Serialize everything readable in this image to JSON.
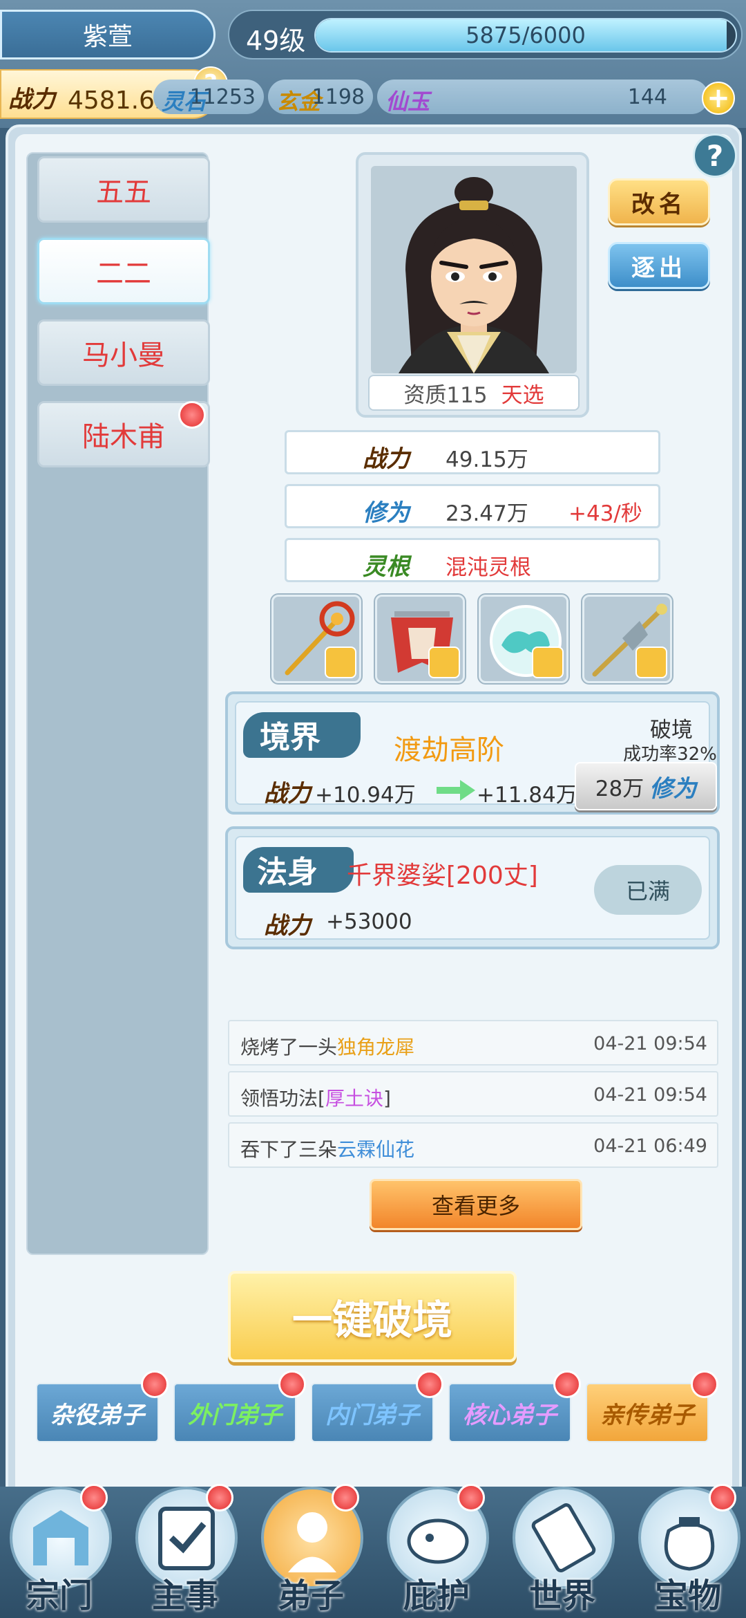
{
  "header": {
    "player_name": "紫萱",
    "level": "49级",
    "exp": "5875/6000",
    "exp_fraction": 0.979,
    "power_label": "战力",
    "power_value": "4581.63万",
    "help_glyph": "?",
    "resources": [
      {
        "label": "灵石",
        "value": "11253",
        "color": "#2b7fc0"
      },
      {
        "label": "玄金",
        "value": "1198",
        "color": "#c98a00"
      },
      {
        "label": "仙玉",
        "value": "144",
        "color": "#a24ad0"
      }
    ],
    "plus_glyph": "+"
  },
  "help_glyph": "?",
  "disciples": [
    {
      "name": "五五",
      "selected": false,
      "alert": false
    },
    {
      "name": "二二",
      "selected": true,
      "alert": false
    },
    {
      "name": "马小曼",
      "selected": false,
      "alert": false
    },
    {
      "name": "陆木甫",
      "selected": false,
      "alert": true
    }
  ],
  "portrait": {
    "aptitude": "资质115",
    "tag": "天选"
  },
  "actions": {
    "rename": "改名",
    "leave": "逐出"
  },
  "stats": {
    "power_label": "战力",
    "power_value": "49.15万",
    "cultivation_label": "修为",
    "cultivation_value": "23.47万",
    "cultivation_rate": "+43/秒",
    "root_label": "灵根",
    "root_value": "混沌灵根"
  },
  "equipment": [
    {
      "icon": "phoenix-staff-icon"
    },
    {
      "icon": "red-robe-icon"
    },
    {
      "icon": "cloud-orb-icon"
    },
    {
      "icon": "golden-spear-icon"
    }
  ],
  "realm": {
    "title": "境界",
    "name": "渡劫高阶",
    "power_label": "战力",
    "power_now": "+10.94万",
    "power_next": "+11.84万",
    "breakthrough_label": "破境",
    "success_rate": "成功率32%",
    "cost": "28万",
    "cost_unit": "修为"
  },
  "dharma_body": {
    "title": "法身",
    "name": "千界婆娑[200丈]",
    "power_label": "战力",
    "power_value": "+53000",
    "status": "已满"
  },
  "log": [
    {
      "prefix": "烧烤了一头",
      "highlight": "独角龙犀",
      "suffix": "",
      "color": "orange",
      "time": "04-21 09:54"
    },
    {
      "prefix": "领悟功法[",
      "highlight": "厚土诀",
      "suffix": "]",
      "color": "purple",
      "time": "04-21 09:54"
    },
    {
      "prefix": "吞下了三朵",
      "highlight": "云霖仙花",
      "suffix": "",
      "color": "blue",
      "time": "04-21 06:49"
    }
  ],
  "more_button": "查看更多",
  "one_key_button": "一键破境",
  "ranks": [
    {
      "label": "杂役弟子",
      "alert": true
    },
    {
      "label": "外门弟子",
      "alert": true
    },
    {
      "label": "内门弟子",
      "alert": true
    },
    {
      "label": "核心弟子",
      "alert": true
    },
    {
      "label": "亲传弟子",
      "alert": true
    }
  ],
  "nav": [
    {
      "label": "宗门",
      "icon": "sect-gate-icon",
      "alert": true
    },
    {
      "label": "主事",
      "icon": "checklist-icon",
      "alert": true
    },
    {
      "label": "弟子",
      "icon": "disciple-icon",
      "alert": true,
      "active": true
    },
    {
      "label": "庇护",
      "icon": "guardian-beast-icon",
      "alert": true
    },
    {
      "label": "世界",
      "icon": "scroll-icon",
      "alert": false
    },
    {
      "label": "宝物",
      "icon": "treasure-bag-icon",
      "alert": true
    }
  ]
}
